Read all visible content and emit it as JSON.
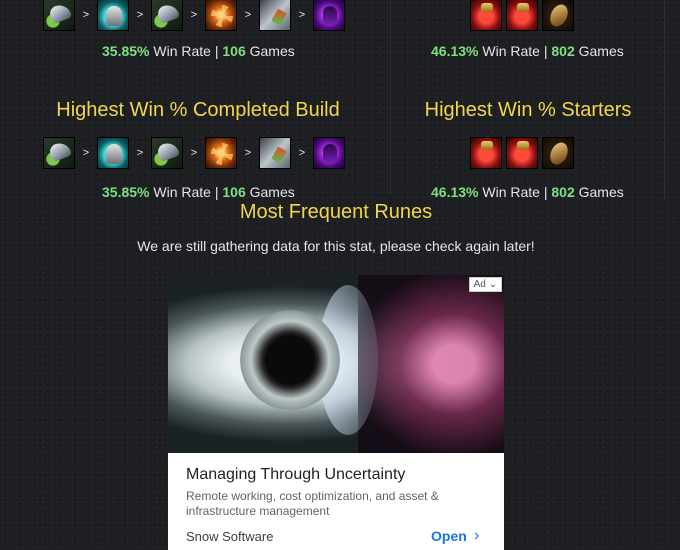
{
  "top": {
    "left_build_items": [
      "boots-icon",
      "helm-icon",
      "boots-icon",
      "sun-icon",
      "blade-icon",
      "void-icon"
    ],
    "left_stat": {
      "win_pct": "35.85%",
      "win_label": "Win Rate |",
      "games": "106",
      "games_label": "Games"
    },
    "right_items": [
      "potion-icon",
      "potion-icon",
      "shield-icon"
    ],
    "right_stat": {
      "win_pct": "46.13%",
      "win_label": "Win Rate |",
      "games": "802",
      "games_label": "Games"
    }
  },
  "completed_build": {
    "title": "Highest Win % Completed Build",
    "separator": ">",
    "items": [
      "boots-icon",
      "helm-icon",
      "boots-icon",
      "sun-icon",
      "blade-icon",
      "void-icon"
    ],
    "stat": {
      "win_pct": "35.85%",
      "win_label": "Win Rate |",
      "games": "106",
      "games_label": "Games"
    }
  },
  "starters": {
    "title": "Highest Win % Starters",
    "items": [
      "potion-icon",
      "potion-icon",
      "shield-icon"
    ],
    "stat": {
      "win_pct": "46.13%",
      "win_label": "Win Rate |",
      "games": "802",
      "games_label": "Games"
    }
  },
  "runes": {
    "title": "Most Frequent Runes",
    "message": "We are still gathering data for this stat, please check again later!"
  },
  "ad": {
    "badge": "Ad",
    "title": "Managing Through Uncertainty",
    "description": "Remote working, cost optimization, and asset & infrastructure management",
    "brand": "Snow Software",
    "cta": "Open",
    "cta_icon": "chevron-right-icon"
  }
}
